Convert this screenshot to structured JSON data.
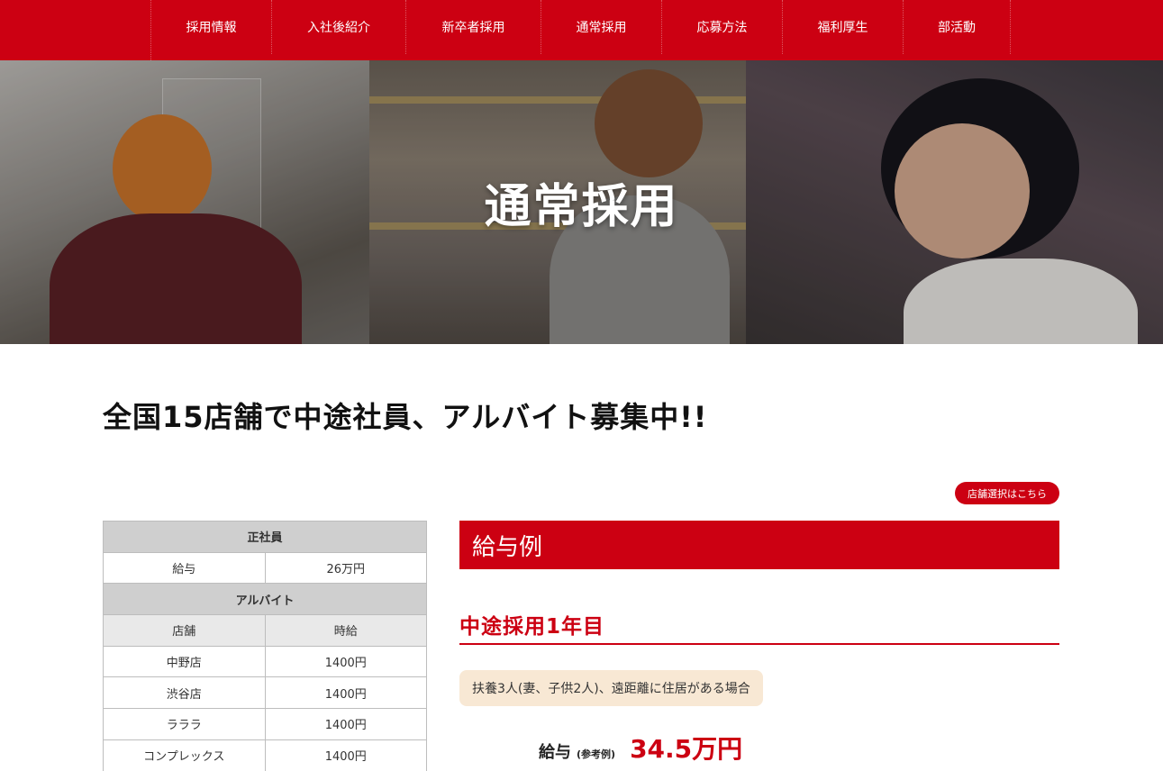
{
  "nav": {
    "items": [
      "採用情報",
      "入社後紹介",
      "新卒者採用",
      "通常採用",
      "応募方法",
      "福利厚生",
      "部活動"
    ]
  },
  "hero": {
    "title": "通常採用"
  },
  "headline": "全国15店舗で中途社員、アルバイト募集中!!",
  "store_button": "店舗選択はこちら",
  "table": {
    "fulltime_header": "正社員",
    "fulltime_rows": [
      {
        "label": "給与",
        "value": "26万円"
      }
    ],
    "parttime_header": "アルバイト",
    "parttime_columns": [
      "店舗",
      "時給"
    ],
    "parttime_rows": [
      {
        "store": "中野店",
        "wage": "1400円"
      },
      {
        "store": "渋谷店",
        "wage": "1400円"
      },
      {
        "store": "ラララ",
        "wage": "1400円"
      },
      {
        "store": "コンプレックス",
        "wage": "1400円"
      }
    ]
  },
  "salary": {
    "heading": "給与例",
    "subheading": "中途採用1年目",
    "condition": "扶養3人(妻、子供2人)、遠距離に住居がある場合",
    "amount_label": "給与",
    "amount_note": "(参考例)",
    "amount_value": "34.5万円"
  },
  "colors": {
    "accent": "#cc0012",
    "condition_bg": "#f8e8d4"
  }
}
